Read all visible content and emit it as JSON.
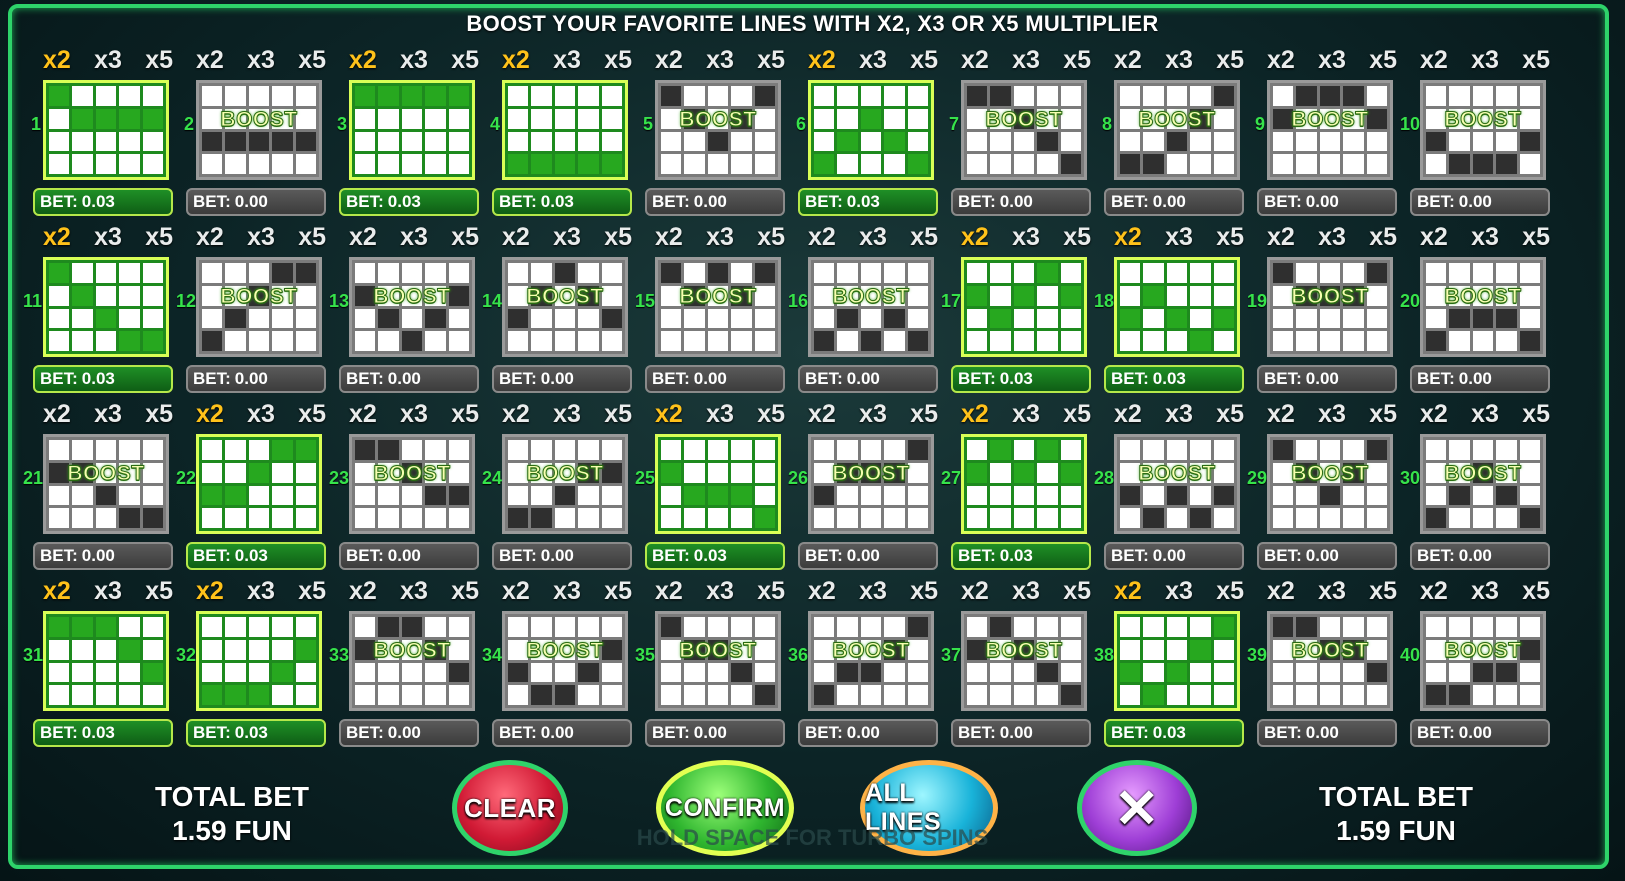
{
  "heading": "BOOST YOUR FAVORITE LINES WITH X2, X3 OR X5 MULTIPLIER",
  "multiplier_labels": [
    "x2",
    "x3",
    "x5"
  ],
  "boost_label": "BOOST",
  "bet_label": "BET:",
  "lines": [
    {
      "number": "1",
      "bet": "0.03",
      "active": true,
      "pattern": [
        0,
        1,
        1,
        1,
        1
      ]
    },
    {
      "number": "2",
      "bet": "0.00",
      "active": false,
      "pattern": [
        2,
        2,
        2,
        2,
        2
      ]
    },
    {
      "number": "3",
      "bet": "0.03",
      "active": true,
      "pattern": [
        0,
        0,
        0,
        0,
        0
      ]
    },
    {
      "number": "4",
      "bet": "0.03",
      "active": true,
      "pattern": [
        3,
        3,
        3,
        3,
        3
      ]
    },
    {
      "number": "5",
      "bet": "0.00",
      "active": false,
      "pattern": [
        0,
        1,
        2,
        1,
        0
      ]
    },
    {
      "number": "6",
      "bet": "0.03",
      "active": true,
      "pattern": [
        3,
        2,
        1,
        2,
        3
      ]
    },
    {
      "number": "7",
      "bet": "0.00",
      "active": false,
      "pattern": [
        0,
        0,
        1,
        2,
        3
      ]
    },
    {
      "number": "8",
      "bet": "0.00",
      "active": false,
      "pattern": [
        3,
        3,
        2,
        1,
        0
      ]
    },
    {
      "number": "9",
      "bet": "0.00",
      "active": false,
      "pattern": [
        1,
        0,
        0,
        0,
        1
      ]
    },
    {
      "number": "10",
      "bet": "0.00",
      "active": false,
      "pattern": [
        2,
        3,
        3,
        3,
        2
      ]
    },
    {
      "number": "11",
      "bet": "0.03",
      "active": true,
      "pattern": [
        0,
        1,
        2,
        3,
        3
      ]
    },
    {
      "number": "12",
      "bet": "0.00",
      "active": false,
      "pattern": [
        3,
        2,
        1,
        0,
        0
      ]
    },
    {
      "number": "13",
      "bet": "0.00",
      "active": false,
      "pattern": [
        1,
        2,
        3,
        2,
        1
      ]
    },
    {
      "number": "14",
      "bet": "0.00",
      "active": false,
      "pattern": [
        2,
        1,
        0,
        1,
        2
      ]
    },
    {
      "number": "15",
      "bet": "0.00",
      "active": false,
      "pattern": [
        0,
        1,
        0,
        1,
        0
      ]
    },
    {
      "number": "16",
      "bet": "0.00",
      "active": false,
      "pattern": [
        3,
        2,
        3,
        2,
        3
      ]
    },
    {
      "number": "17",
      "bet": "0.03",
      "active": true,
      "pattern": [
        1,
        2,
        1,
        0,
        1
      ]
    },
    {
      "number": "18",
      "bet": "0.03",
      "active": true,
      "pattern": [
        2,
        1,
        2,
        3,
        2
      ]
    },
    {
      "number": "19",
      "bet": "0.00",
      "active": false,
      "pattern": [
        0,
        1,
        1,
        1,
        0
      ]
    },
    {
      "number": "20",
      "bet": "0.00",
      "active": false,
      "pattern": [
        3,
        2,
        2,
        2,
        3
      ]
    },
    {
      "number": "21",
      "bet": "0.00",
      "active": false,
      "pattern": [
        1,
        1,
        2,
        3,
        3
      ]
    },
    {
      "number": "22",
      "bet": "0.03",
      "active": true,
      "pattern": [
        2,
        2,
        1,
        0,
        0
      ]
    },
    {
      "number": "23",
      "bet": "0.00",
      "active": false,
      "pattern": [
        0,
        0,
        1,
        2,
        2
      ]
    },
    {
      "number": "24",
      "bet": "0.00",
      "active": false,
      "pattern": [
        3,
        3,
        2,
        1,
        1
      ]
    },
    {
      "number": "25",
      "bet": "0.03",
      "active": true,
      "pattern": [
        1,
        2,
        2,
        2,
        3
      ]
    },
    {
      "number": "26",
      "bet": "0.00",
      "active": false,
      "pattern": [
        2,
        1,
        1,
        1,
        0
      ]
    },
    {
      "number": "27",
      "bet": "0.03",
      "active": true,
      "pattern": [
        1,
        0,
        1,
        0,
        1
      ]
    },
    {
      "number": "28",
      "bet": "0.00",
      "active": false,
      "pattern": [
        2,
        3,
        2,
        3,
        2
      ]
    },
    {
      "number": "29",
      "bet": "0.00",
      "active": false,
      "pattern": [
        0,
        1,
        2,
        1,
        0
      ]
    },
    {
      "number": "30",
      "bet": "0.00",
      "active": false,
      "pattern": [
        3,
        2,
        1,
        2,
        3
      ]
    },
    {
      "number": "31",
      "bet": "0.03",
      "active": true,
      "pattern": [
        0,
        0,
        0,
        1,
        2
      ]
    },
    {
      "number": "32",
      "bet": "0.03",
      "active": true,
      "pattern": [
        3,
        3,
        3,
        2,
        1
      ]
    },
    {
      "number": "33",
      "bet": "0.00",
      "active": false,
      "pattern": [
        1,
        0,
        0,
        1,
        2
      ]
    },
    {
      "number": "34",
      "bet": "0.00",
      "active": false,
      "pattern": [
        2,
        3,
        3,
        2,
        1
      ]
    },
    {
      "number": "35",
      "bet": "0.00",
      "active": false,
      "pattern": [
        0,
        1,
        1,
        2,
        3
      ]
    },
    {
      "number": "36",
      "bet": "0.00",
      "active": false,
      "pattern": [
        3,
        2,
        2,
        1,
        0
      ]
    },
    {
      "number": "37",
      "bet": "0.00",
      "active": false,
      "pattern": [
        1,
        0,
        1,
        2,
        3
      ]
    },
    {
      "number": "38",
      "bet": "0.03",
      "active": true,
      "pattern": [
        2,
        3,
        2,
        1,
        0
      ]
    },
    {
      "number": "39",
      "bet": "0.00",
      "active": false,
      "pattern": [
        0,
        0,
        1,
        1,
        2
      ]
    },
    {
      "number": "40",
      "bet": "0.00",
      "active": false,
      "pattern": [
        3,
        3,
        2,
        2,
        1
      ]
    }
  ],
  "total_bet": {
    "label": "TOTAL BET",
    "value": "1.59 FUN"
  },
  "buttons": {
    "clear": "CLEAR",
    "confirm": "CONFIRM",
    "all_lines": "ALL LINES",
    "close": "✕"
  },
  "footer_hint": "HOLD SPACE FOR TURBO SPINS",
  "colors": {
    "frame": "#2ed36a",
    "active_green": "#27a81f",
    "active_multiplier": "#ffc21a",
    "line_number": "#36e34b"
  }
}
